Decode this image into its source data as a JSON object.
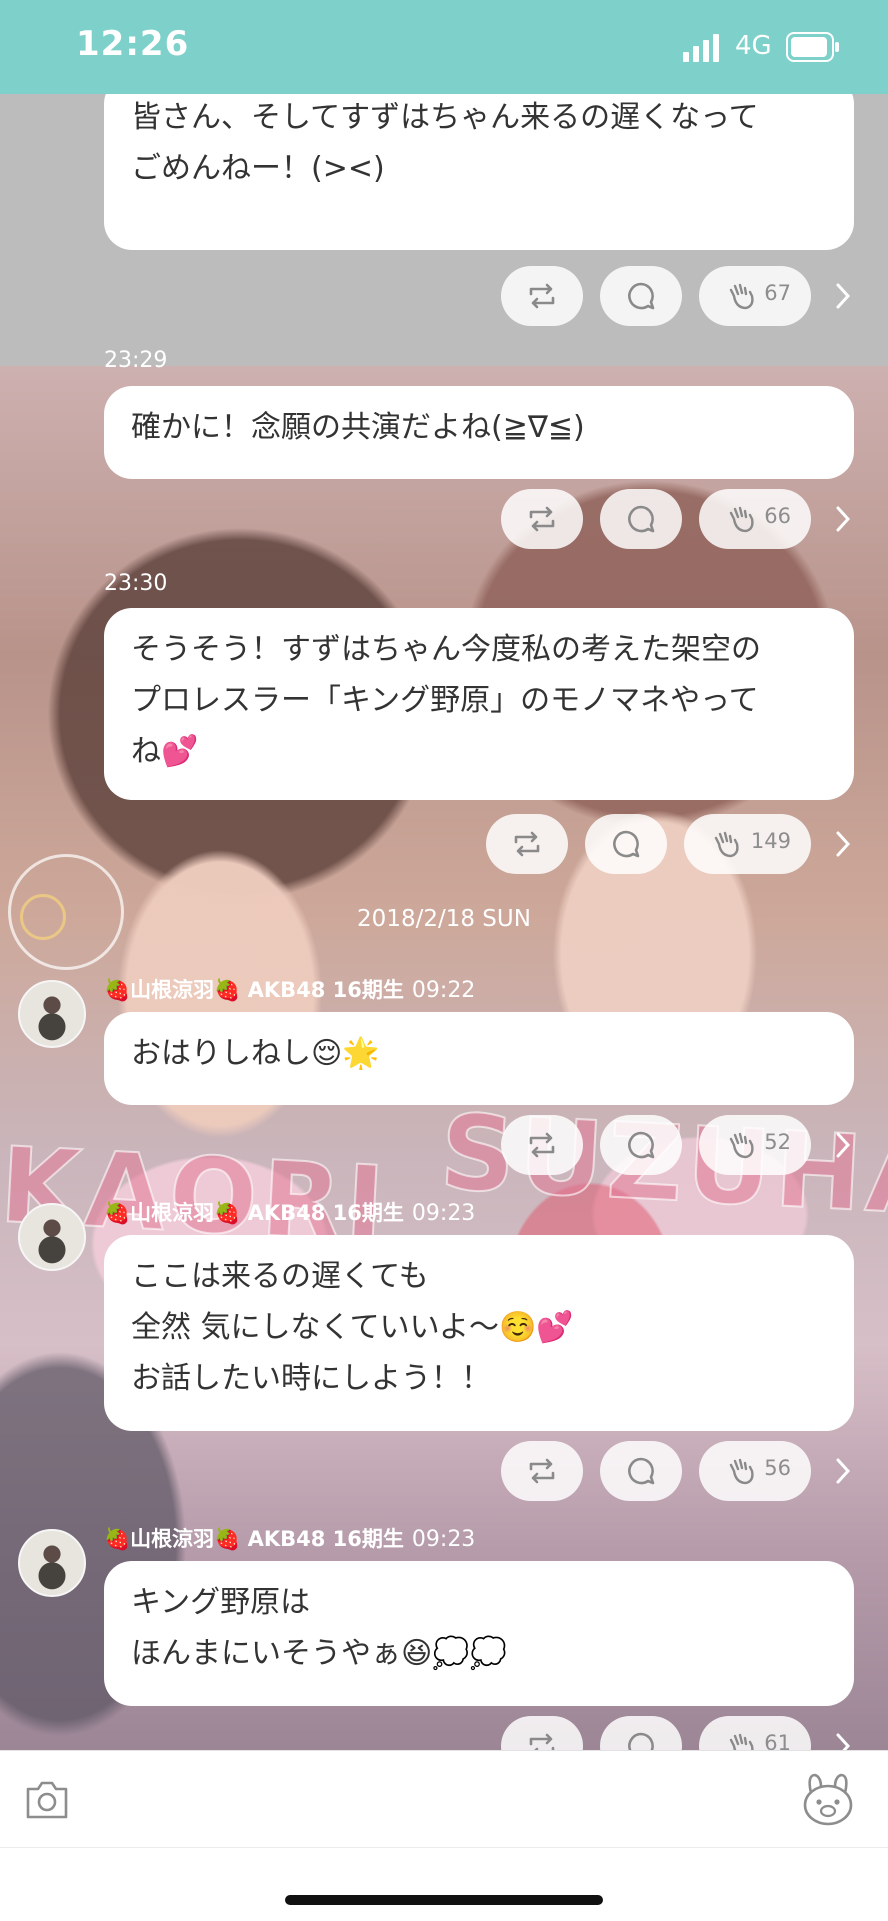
{
  "status_bar": {
    "time": "12:26",
    "network": "4G"
  },
  "messages": [
    {
      "lines": [
        "皆さん、そしてすずはちゃん来るの遅くなって",
        "ごめんねー！(><)"
      ],
      "claps": "67"
    },
    {
      "timestamp": "23:29",
      "lines": [
        "確かに！念願の共演だよね(≧∇≦)"
      ],
      "claps": "66"
    },
    {
      "timestamp": "23:30",
      "lines": [
        "そうそう！すずはちゃん今度私の考えた架空の",
        "プロレスラー「キング野原」のモノマネやって",
        "ね💕"
      ],
      "claps": "149"
    },
    {
      "sender": "🍓山根涼羽🍓 AKB48 16期生",
      "time": "09:22",
      "lines": [
        "おはりしねし😌🌟"
      ],
      "claps": "52"
    },
    {
      "sender": "🍓山根涼羽🍓 AKB48 16期生",
      "time": "09:23",
      "lines": [
        "ここは来るの遅くても",
        "全然 気にしなくていいよ～☺️💕",
        "お話したい時にしよう！！"
      ],
      "claps": "56"
    },
    {
      "sender": "🍓山根涼羽🍓 AKB48 16期生",
      "time": "09:23",
      "lines": [
        "キング野原は",
        "ほんまにいそうやぁ😆💭💭"
      ],
      "claps": "61"
    }
  ],
  "date_separator": "2018/2/18 SUN",
  "background_text": {
    "left": "KAORI",
    "right": "SUZUHA"
  },
  "colors": {
    "status_bar": "#7dd1ca",
    "bubble": "#ffffff",
    "text": "#333333"
  },
  "icons": [
    "retweet-icon",
    "comment-icon",
    "clap-icon",
    "chevron-right-icon",
    "camera-icon",
    "mascot-icon"
  ]
}
